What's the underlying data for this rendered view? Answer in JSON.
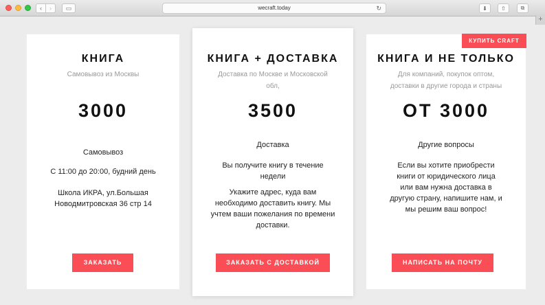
{
  "browser": {
    "url": "wecraft.today",
    "back_icon": "‹",
    "forward_icon": "›",
    "sidebar_icon": "▭",
    "reload_icon": "↻",
    "download_icon": "⬇",
    "share_icon": "⇧",
    "tabs_icon": "⧉",
    "new_tab_icon": "+"
  },
  "buy_craft_label": "КУПИТЬ CRAFT",
  "cards": [
    {
      "title": "КНИГА",
      "subtitle": "Самовывоз из Москвы",
      "price": "3000",
      "lines": [
        "Самовывоз",
        "С 11:00 до 20:00, будний день",
        "Школа ИКРА, ул.Большая Новодмитровская 36 стр 14"
      ],
      "button": "ЗАКАЗАТЬ"
    },
    {
      "title": "КНИГА + ДОСТАВКА",
      "subtitle": "Доставка по Москве и Московской обл,",
      "price": "3500",
      "lines": [
        "Доставка",
        "Вы получите книгу в течение недели",
        "Укажите адрес, куда вам необходимо доставить книгу. Мы учтем ваши пожелания по времени доставки."
      ],
      "button": "ЗАКАЗАТЬ С ДОСТАВКОЙ"
    },
    {
      "title": "КНИГА И НЕ ТОЛЬКО",
      "subtitle": "Для компаний, покупок оптом, доставки в другие города и страны",
      "price": "ОТ 3000",
      "lines": [
        "Другие вопросы",
        "Если вы хотите приобрести книги от юридического лица или вам нужна доставка в другую страну, напишите нам, и мы решим ваш вопрос!"
      ],
      "button": "НАПИСАТЬ НА ПОЧТУ"
    }
  ],
  "colors": {
    "accent": "#fb4d55",
    "background": "#ececec"
  }
}
